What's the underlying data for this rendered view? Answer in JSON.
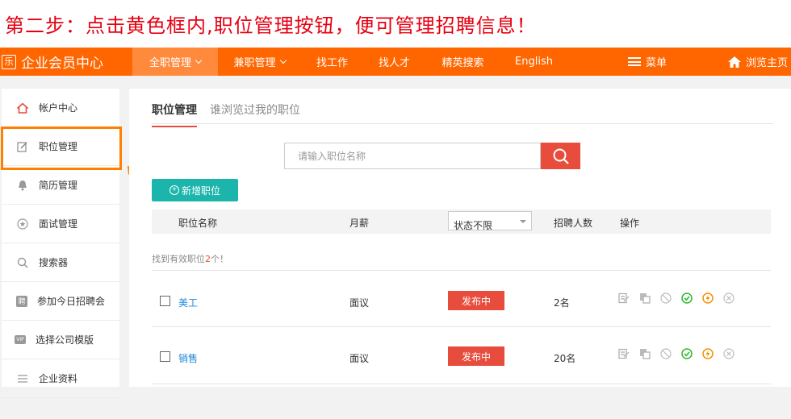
{
  "caption": "第二步：点击黄色框内,职位管理按钮，便可管理招聘信息！",
  "navbar": {
    "brand_icon": "乐",
    "brand_text": "企业会员中心",
    "items": [
      {
        "label": "全职管理",
        "has_chevron": true,
        "active": true
      },
      {
        "label": "兼职管理",
        "has_chevron": true,
        "active": false
      },
      {
        "label": "找工作"
      },
      {
        "label": "找人才"
      },
      {
        "label": "精英搜索"
      },
      {
        "label": "English"
      }
    ],
    "menu_label": "菜单",
    "home_label": "浏览主页"
  },
  "sidebar": {
    "items": [
      {
        "label": "帐户中心",
        "icon": "home-icon"
      },
      {
        "label": "职位管理",
        "icon": "edit-icon"
      },
      {
        "label": "简历管理",
        "icon": "bell-icon"
      },
      {
        "label": "面试管理",
        "icon": "star-icon"
      },
      {
        "label": "搜索器",
        "icon": "search-icon"
      },
      {
        "label": "参加今日招聘会",
        "icon": "recruit-icon",
        "icon_text": "聘"
      },
      {
        "label": "选择公司模版",
        "icon": "vip-icon",
        "icon_text": "VIP"
      },
      {
        "label": "企业资料",
        "icon": "list-icon"
      }
    ]
  },
  "tabs": [
    {
      "label": "职位管理",
      "active": true
    },
    {
      "label": "谁浏览过我的职位",
      "active": false
    }
  ],
  "search": {
    "placeholder": "请输入职位名称"
  },
  "add_button": "新增职位",
  "table": {
    "headers": {
      "name": "职位名称",
      "salary": "月薪",
      "status_select": "状态不限",
      "count": "招聘人数",
      "ops": "操作"
    },
    "found_prefix": "找到有效职位",
    "found_count": "2",
    "found_suffix": "个！",
    "rows": [
      {
        "name": "美工",
        "salary": "面议",
        "status": "发布中",
        "count": "2名"
      },
      {
        "name": "销售",
        "salary": "面议",
        "status": "发布中",
        "count": "20名"
      }
    ]
  },
  "colors": {
    "brand_orange": "#ff6600",
    "caption_red": "#e60012",
    "accent_red": "#e84c3d",
    "teal": "#1cb5ac",
    "link_blue": "#1e88d9",
    "highlight_orange": "#ff7f00"
  }
}
